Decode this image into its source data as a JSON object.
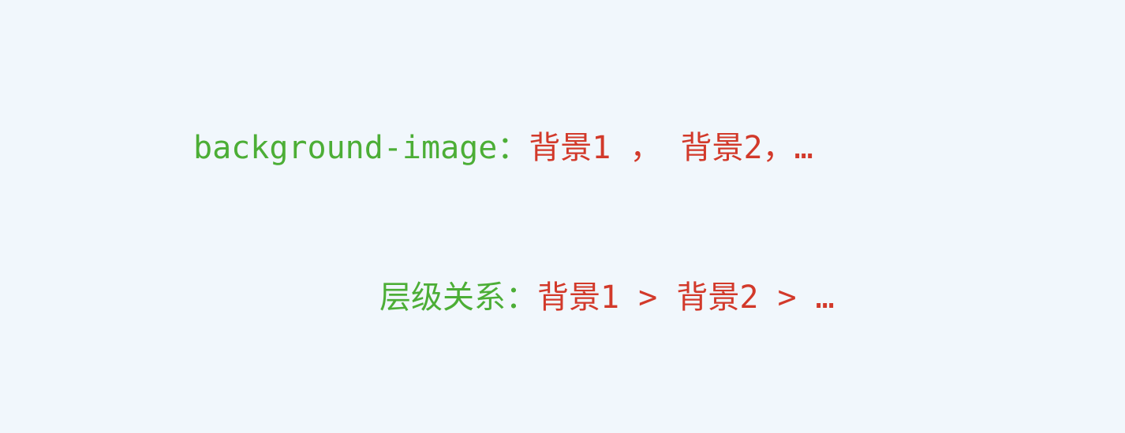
{
  "colors": {
    "background": "#f1f7fc",
    "label_green": "#4cae36",
    "value_red": "#d2392a"
  },
  "line1": {
    "label": "background-image：",
    "value": "背景1 ， 背景2，…"
  },
  "line2": {
    "label": "层级关系：",
    "value": "背景1 > 背景2 > …"
  }
}
